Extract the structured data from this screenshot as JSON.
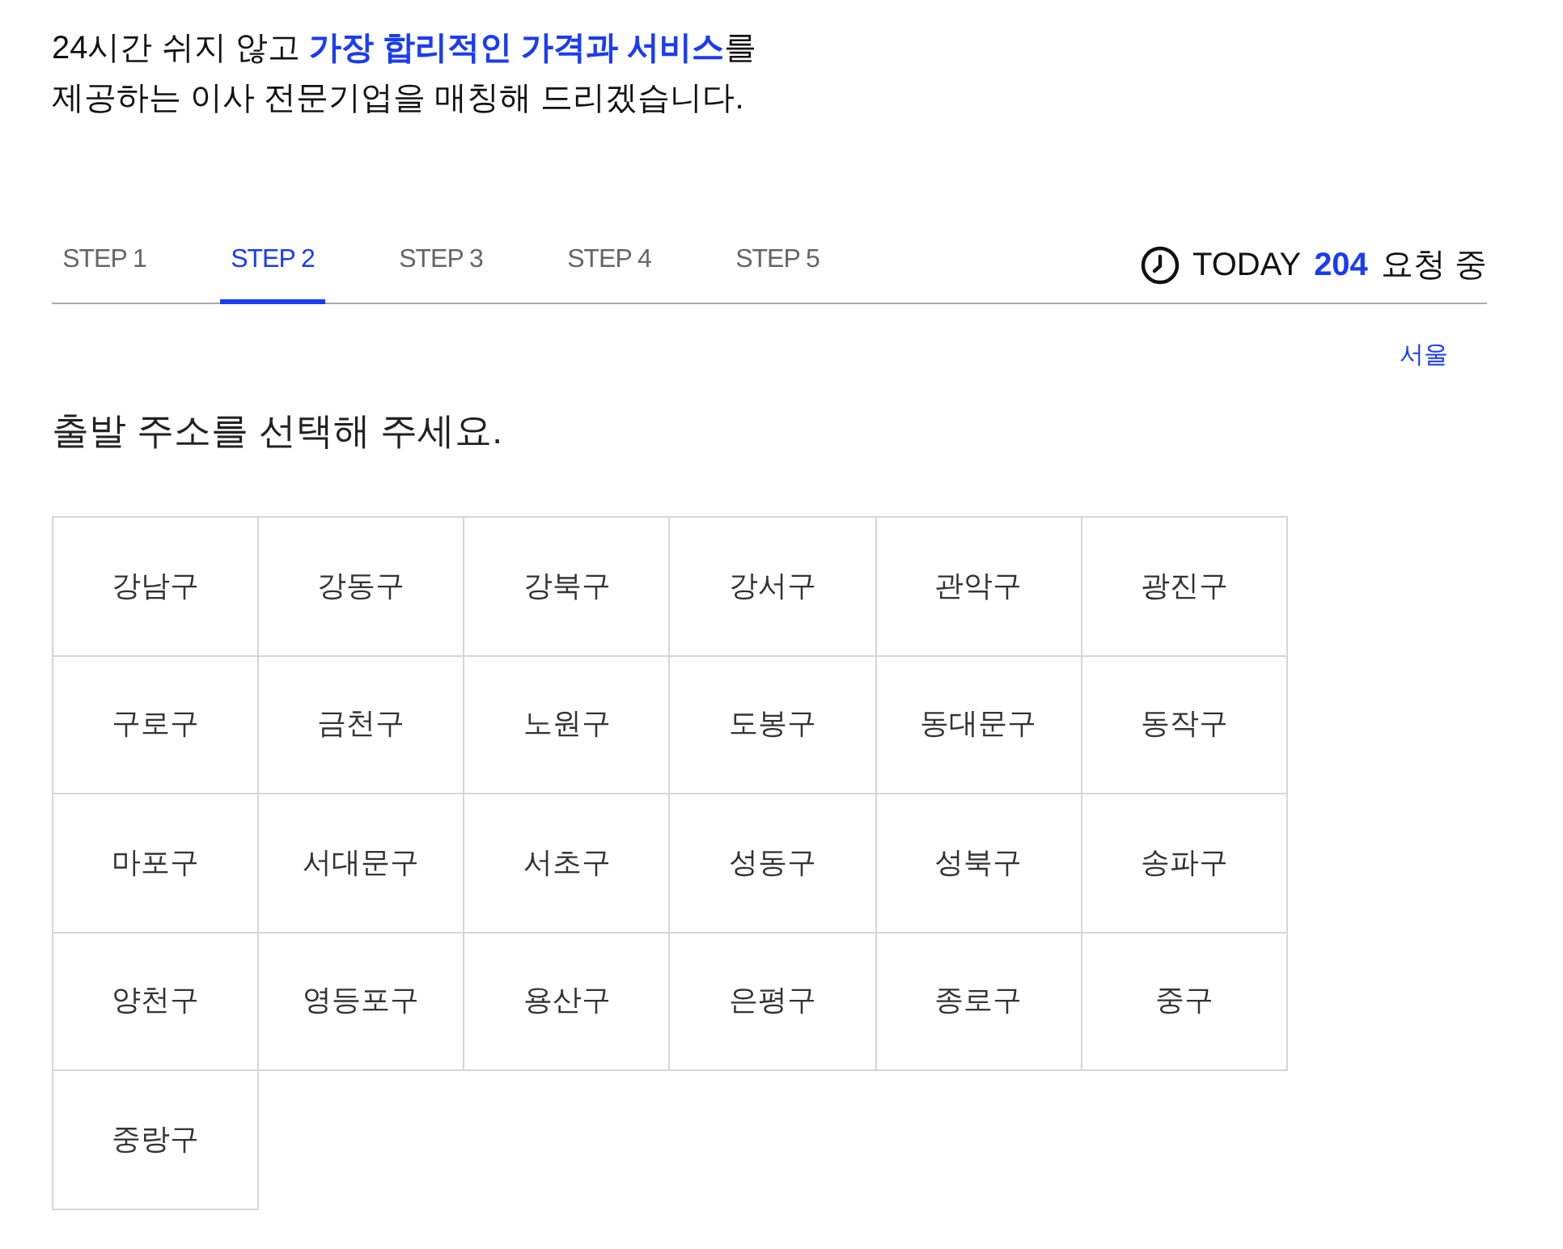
{
  "headline": {
    "lines": [
      "24시간 쉬지 않고 **가장 합리적인 가격과 서비스**를",
      "제공하는 이사 전문기업을 매칭해 드리겠습니다."
    ]
  },
  "tabs": [
    {
      "label": "STEP 1",
      "selected": false
    },
    {
      "label": "STEP 2",
      "selected": true
    },
    {
      "label": "STEP 3",
      "selected": false
    },
    {
      "label": "STEP 4",
      "selected": false
    },
    {
      "label": "STEP 5",
      "selected": false
    }
  ],
  "today_counter": {
    "prefix": "TODAY",
    "count": "204",
    "suffix": "요청 중"
  },
  "region_link": "서울",
  "prompt": "출발 주소를 선택해 주세요.",
  "districts": [
    {
      "label": "강남구",
      "selected": false
    },
    {
      "label": "강동구",
      "selected": false
    },
    {
      "label": "강북구",
      "selected": false
    },
    {
      "label": "강서구",
      "selected": false
    },
    {
      "label": "관악구",
      "selected": false
    },
    {
      "label": "광진구",
      "selected": false
    },
    {
      "label": "구로구",
      "selected": false
    },
    {
      "label": "금천구",
      "selected": false
    },
    {
      "label": "노원구",
      "selected": false
    },
    {
      "label": "도봉구",
      "selected": false
    },
    {
      "label": "동대문구",
      "selected": false
    },
    {
      "label": "동작구",
      "selected": false
    },
    {
      "label": "마포구",
      "selected": false
    },
    {
      "label": "서대문구",
      "selected": false
    },
    {
      "label": "서초구",
      "selected": false
    },
    {
      "label": "성동구",
      "selected": false
    },
    {
      "label": "성북구",
      "selected": false
    },
    {
      "label": "송파구",
      "selected": false
    },
    {
      "label": "양천구",
      "selected": false
    },
    {
      "label": "영등포구",
      "selected": false
    },
    {
      "label": "용산구",
      "selected": false
    },
    {
      "label": "은평구",
      "selected": false
    },
    {
      "label": "종로구",
      "selected": false
    },
    {
      "label": "중구",
      "selected": false
    },
    {
      "label": "중랑구",
      "selected": false
    }
  ]
}
